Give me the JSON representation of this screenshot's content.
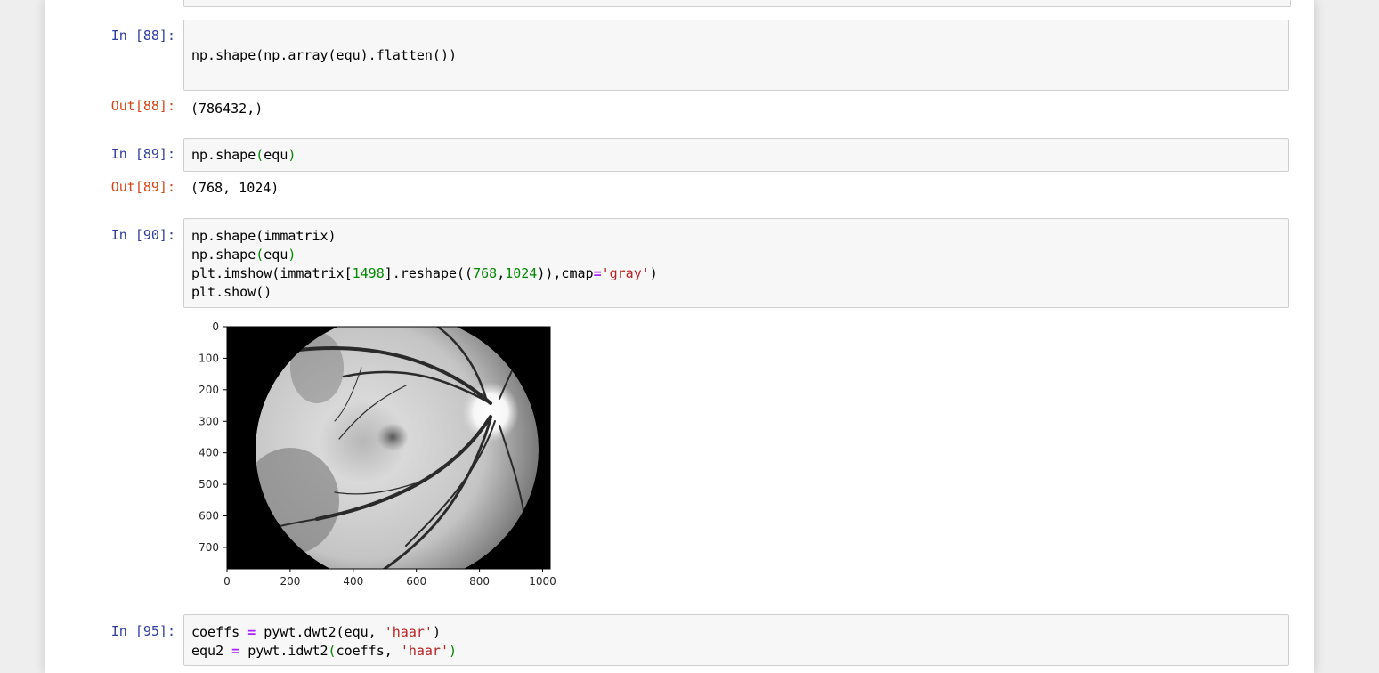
{
  "cells": [
    {
      "in_prompt": "In [88]:",
      "out_prompt": "Out[88]:",
      "output": "(786432,)"
    },
    {
      "in_prompt": "In [89]:",
      "out_prompt": "Out[89]:",
      "output": "(768, 1024)"
    },
    {
      "in_prompt": "In [90]:"
    },
    {
      "in_prompt": "In [95]:"
    }
  ],
  "code_tokens": {
    "c88": [
      "np.shape(np.array(equ).flatten())"
    ],
    "c89": [
      "np.shape",
      "(",
      "equ",
      ")"
    ],
    "c90_l1": [
      "np.shape(immatrix)"
    ],
    "c90_l2": [
      "np.shape",
      "(",
      "equ",
      ")"
    ],
    "c90_l3": [
      "plt.imshow(immatrix[",
      "1498",
      "].reshape((",
      "768",
      ",",
      "1024",
      ")),cmap",
      "=",
      "'gray'",
      ")"
    ],
    "c90_l4": [
      "plt.show()"
    ],
    "c95_l1": [
      "coeffs ",
      "=",
      " pywt.dwt2(equ, ",
      "'haar'",
      ")"
    ],
    "c95_l2": [
      "equ2 ",
      "=",
      " pywt.idwt2",
      "(",
      "coeffs, ",
      "'haar'",
      ")"
    ]
  },
  "plot": {
    "x_ticks": [
      "0",
      "200",
      "400",
      "600",
      "800",
      "1000"
    ],
    "y_ticks": [
      "0",
      "100",
      "200",
      "300",
      "400",
      "500",
      "600",
      "700"
    ],
    "x_tick_values": [
      0,
      200,
      400,
      600,
      800,
      1000
    ],
    "y_tick_values": [
      0,
      100,
      200,
      300,
      400,
      500,
      600,
      700
    ],
    "xlim": [
      0,
      1024
    ],
    "ylim": [
      768,
      0
    ],
    "image": "retinal fundus image (grayscale)",
    "cmap": "gray"
  }
}
